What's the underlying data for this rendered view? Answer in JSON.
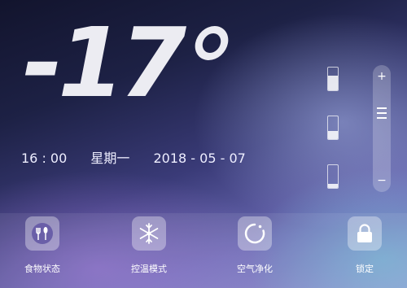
{
  "temperature": {
    "value": "-17"
  },
  "datetime": {
    "time": "16 : 00",
    "weekday": "星期一",
    "date": "2018 - 05 - 07"
  },
  "slider": {
    "plus": "+",
    "minus": "−"
  },
  "toolbar": {
    "items": [
      {
        "label": "食物状态",
        "icon": "food-icon"
      },
      {
        "label": "控温模式",
        "icon": "snowflake-icon"
      },
      {
        "label": "空气净化",
        "icon": "air-purify-icon"
      },
      {
        "label": "锁定",
        "icon": "lock-icon"
      }
    ]
  }
}
